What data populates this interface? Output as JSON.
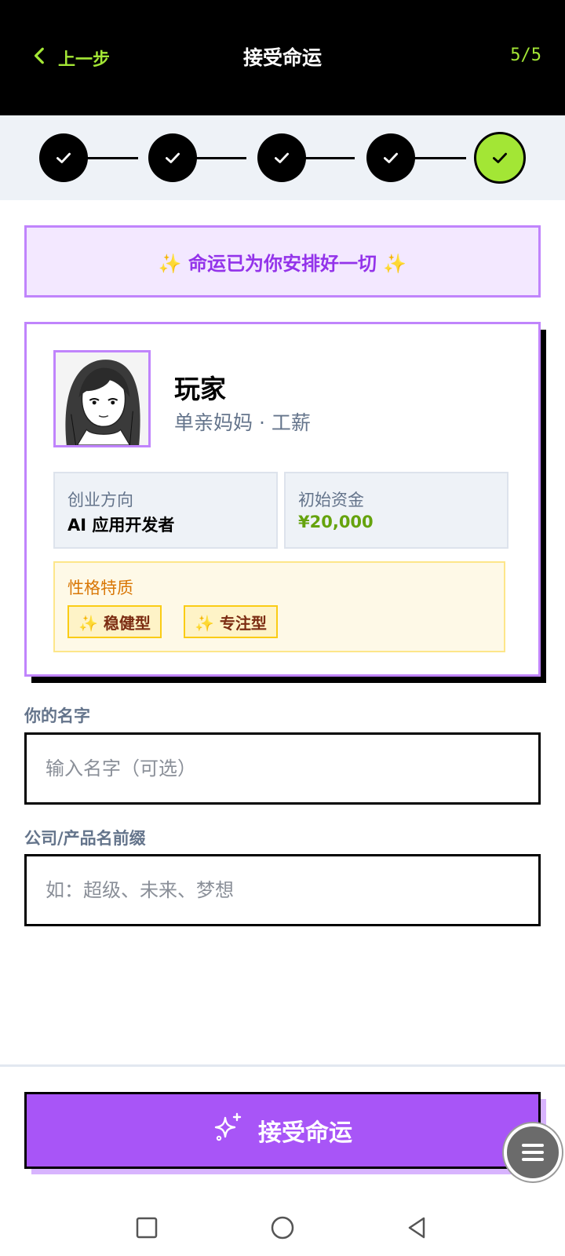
{
  "header": {
    "back_label": "上一步",
    "title": "接受命运",
    "step_indicator": "5/5"
  },
  "stepper": {
    "total_steps": 5,
    "current_step": 5,
    "completed_color": "#000000",
    "current_color": "#a3e635"
  },
  "banner": {
    "text": "✨ 命运已为你安排好一切 ✨"
  },
  "profile": {
    "avatar_icon": "anime-girl-portrait",
    "name": "玩家",
    "role": "单亲妈妈 · 工薪",
    "direction_label": "创业方向",
    "direction_value": "AI 应用开发者",
    "funds_label": "初始资金",
    "funds_value": "¥20,000",
    "traits_label": "性格特质",
    "traits": [
      "✨ 稳健型",
      "✨ 专注型"
    ]
  },
  "form": {
    "name_label": "你的名字",
    "name_value": "",
    "name_placeholder": "输入名字（可选）",
    "prefix_label": "公司/产品名前缀",
    "prefix_value": "",
    "prefix_placeholder": "如：超级、未来、梦想"
  },
  "footer": {
    "accept_label": "接受命运",
    "accept_icon": "sparkles-icon",
    "accent_color": "#a855f7"
  },
  "system_nav": {
    "recents_icon": "square-icon",
    "home_icon": "circle-icon",
    "back_icon": "triangle-back-icon"
  }
}
